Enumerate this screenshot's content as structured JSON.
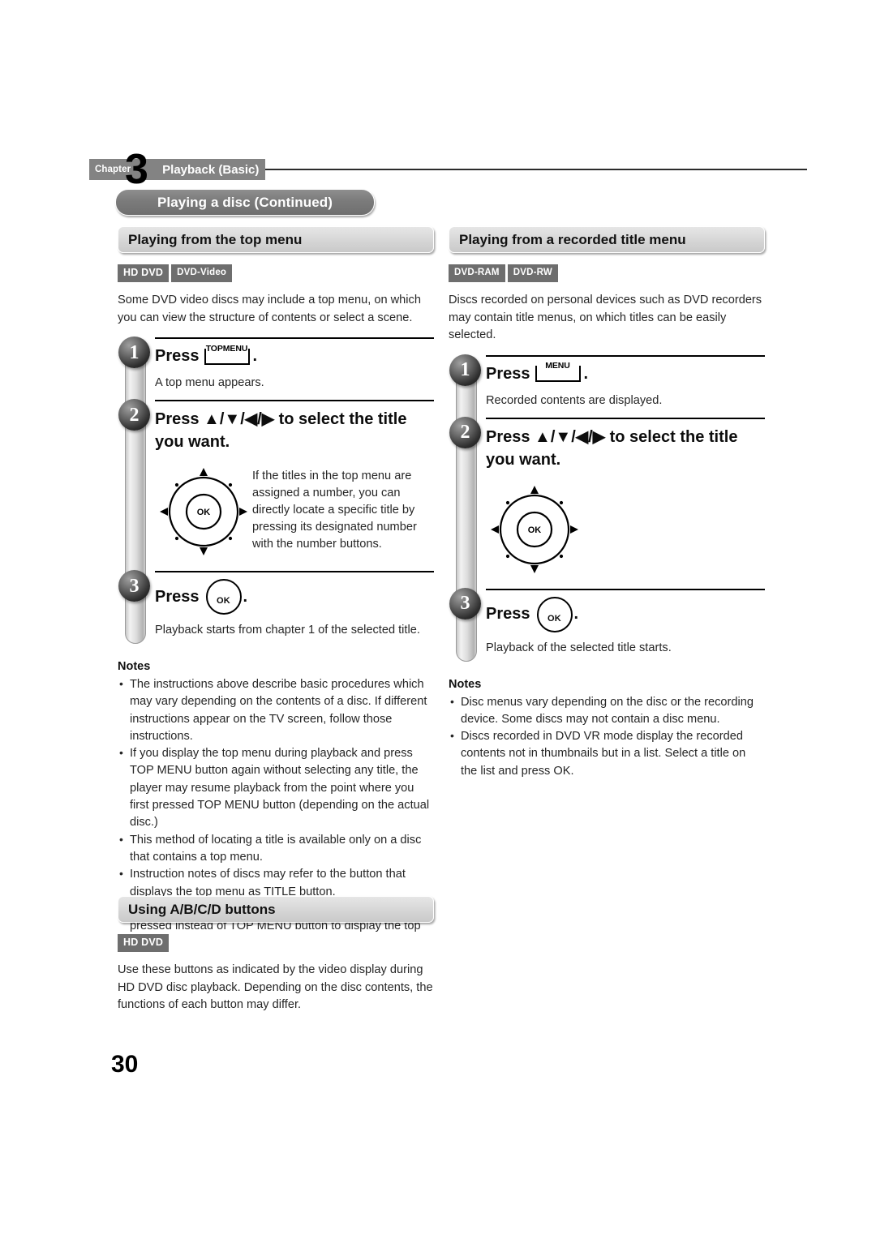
{
  "header": {
    "chapter_word": "Chapter",
    "chapter_number": "3",
    "chapter_title": "Playback (Basic)",
    "banner": "Playing a disc (Continued)"
  },
  "left_column": {
    "section_title": "Playing from the top menu",
    "badges": [
      "HD DVD",
      "DVD-Video"
    ],
    "intro": "Some DVD video discs may include a top menu, on which you can view the structure of contents or select a scene.",
    "steps": [
      {
        "number": "1",
        "press_word": "Press",
        "key_label": "TOPMENU",
        "description": "A top menu appears."
      },
      {
        "number": "2",
        "title": "Press ▲/▼/◀/▶ to select the title you want.",
        "note": "If the titles in the top menu are assigned a number, you can directly locate a specific title by pressing its designated number with the number buttons."
      },
      {
        "number": "3",
        "press_word": "Press",
        "key_label": "OK",
        "description": "Playback starts from chapter 1 of the selected title."
      }
    ],
    "notes_title": "Notes",
    "notes": [
      "The instructions above describe basic procedures which may vary depending on the contents of a disc. If different instructions appear on the TV screen, follow those instructions.",
      "If you display the top menu during playback and press TOP MENU button again without selecting any title, the player may resume playback from the point where you first pressed TOP MENU button (depending on the actual disc.)",
      "This method of locating a title is available only on a disc that contains a top menu.",
      "Instruction notes of discs may refer to the button that displays the top menu as TITLE button.",
      "Depending on a disc, MENU button may have to be pressed instead of TOP MENU button to display the top menu."
    ]
  },
  "right_column": {
    "section_title": "Playing from a recorded title menu",
    "badges": [
      "DVD-RAM",
      "DVD-RW"
    ],
    "intro": "Discs recorded on personal devices such as DVD recorders may contain title menus, on which titles can be easily selected.",
    "steps": [
      {
        "number": "1",
        "press_word": "Press",
        "key_label": "MENU",
        "description": "Recorded contents are displayed."
      },
      {
        "number": "2",
        "title": "Press ▲/▼/◀/▶ to select the title you want.",
        "note": ""
      },
      {
        "number": "3",
        "press_word": "Press",
        "key_label": "OK",
        "description": "Playback of the selected title starts."
      }
    ],
    "notes_title": "Notes",
    "notes": [
      "Disc menus vary depending on the disc or the recording device. Some discs may not contain a disc menu.",
      "Discs recorded in DVD VR mode display the recorded contents not in thumbnails but in a list. Select a title on the list and press OK."
    ]
  },
  "bottom_section": {
    "section_title": "Using A/B/C/D buttons",
    "badges": [
      "HD DVD"
    ],
    "body": "Use these buttons as indicated by the video display during HD DVD disc playback. Depending on the disc contents, the functions of each button may differ."
  },
  "page_number": "30"
}
